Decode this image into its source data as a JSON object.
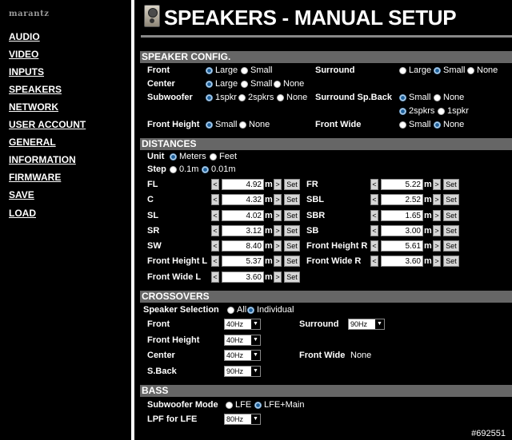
{
  "brand": "marantz",
  "nav": [
    "AUDIO",
    "VIDEO",
    "INPUTS",
    "SPEAKERS",
    "NETWORK",
    "USER ACCOUNT",
    "GENERAL",
    "INFORMATION",
    "FIRMWARE",
    "SAVE",
    "LOAD"
  ],
  "page_title": "SPEAKERS - MANUAL SETUP",
  "speaker_config": {
    "heading": "SPEAKER CONFIG.",
    "front": {
      "label": "Front",
      "options": [
        "Large",
        "Small"
      ],
      "selected": "Large"
    },
    "center": {
      "label": "Center",
      "options": [
        "Large",
        "Small",
        "None"
      ],
      "selected": "Large"
    },
    "subwoofer": {
      "label": "Subwoofer",
      "options": [
        "1spkr",
        "2spkrs",
        "None"
      ],
      "selected": "1spkr"
    },
    "front_height": {
      "label": "Front Height",
      "options": [
        "Small",
        "None"
      ],
      "selected": "Small"
    },
    "surround": {
      "label": "Surround",
      "options": [
        "Large",
        "Small",
        "None"
      ],
      "selected": "Small"
    },
    "surround_back": {
      "label": "Surround Sp.Back",
      "options": [
        "Small",
        "None"
      ],
      "selected": "Small"
    },
    "surround_back_count": {
      "options": [
        "2spkrs",
        "1spkr"
      ],
      "selected": "2spkrs"
    },
    "front_wide": {
      "label": "Front Wide",
      "options": [
        "Small",
        "None"
      ],
      "selected": "None"
    }
  },
  "distances": {
    "heading": "DISTANCES",
    "unit": {
      "label": "Unit",
      "options": [
        "Meters",
        "Feet"
      ],
      "selected": "Meters"
    },
    "step": {
      "label": "Step",
      "options": [
        "0.1m",
        "0.01m"
      ],
      "selected": "0.01m"
    },
    "unit_suffix": "m",
    "decrement": "<",
    "increment": ">",
    "set_label": "Set",
    "left": [
      {
        "label": "FL",
        "value": "4.92"
      },
      {
        "label": "C",
        "value": "4.32"
      },
      {
        "label": "SL",
        "value": "4.02"
      },
      {
        "label": "SR",
        "value": "3.12"
      },
      {
        "label": "SW",
        "value": "8.40"
      },
      {
        "label": "Front Height L",
        "value": "5.37"
      },
      {
        "label": "Front Wide L",
        "value": "3.60"
      }
    ],
    "right": [
      {
        "label": "FR",
        "value": "5.22"
      },
      {
        "label": "SBL",
        "value": "2.52"
      },
      {
        "label": "SBR",
        "value": "1.65"
      },
      {
        "label": "SB",
        "value": "3.00"
      },
      {
        "label": "Front Height R",
        "value": "5.61"
      },
      {
        "label": "Front Wide R",
        "value": "3.60"
      }
    ]
  },
  "crossovers": {
    "heading": "CROSSOVERS",
    "speaker_selection": {
      "label": "Speaker Selection",
      "options": [
        "All",
        "Individual"
      ],
      "selected": "Individual"
    },
    "front": {
      "label": "Front",
      "value": "40Hz"
    },
    "surround": {
      "label": "Surround",
      "value": "90Hz"
    },
    "front_height": {
      "label": "Front Height",
      "value": "40Hz"
    },
    "center": {
      "label": "Center",
      "value": "40Hz"
    },
    "front_wide": {
      "label": "Front Wide",
      "value": "None"
    },
    "sback": {
      "label": "S.Back",
      "value": "90Hz"
    }
  },
  "bass": {
    "heading": "BASS",
    "subwoofer_mode": {
      "label": "Subwoofer Mode",
      "options": [
        "LFE",
        "LFE+Main"
      ],
      "selected": "LFE+Main"
    },
    "lpf": {
      "label": "LPF for LFE",
      "value": "80Hz"
    }
  },
  "image_tag": "#692551",
  "icons": {
    "title": "speaker-icon",
    "dropdown": "chevron-down-icon"
  }
}
